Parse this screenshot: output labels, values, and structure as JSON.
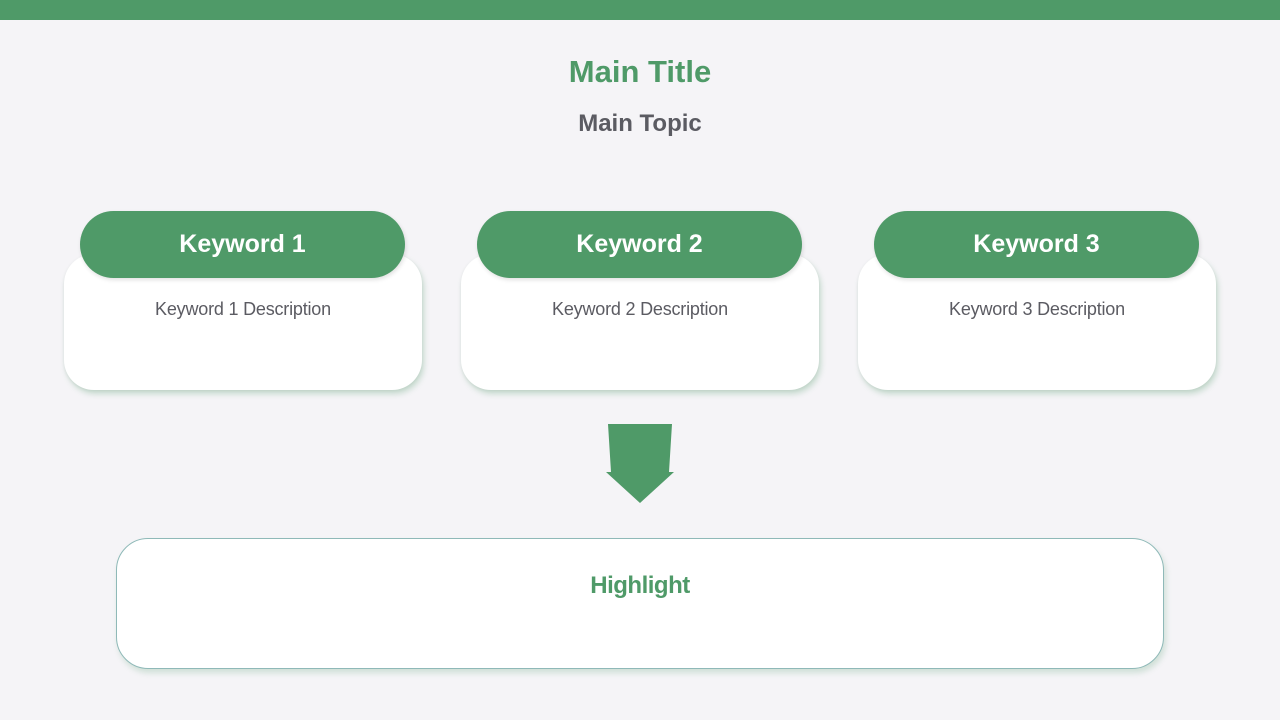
{
  "header": {
    "title": "Main Title",
    "topic": "Main Topic"
  },
  "keywords": [
    {
      "label": "Keyword 1",
      "description": "Keyword 1 Description"
    },
    {
      "label": "Keyword 2",
      "description": "Keyword 2 Description"
    },
    {
      "label": "Keyword 3",
      "description": "Keyword 3 Description"
    }
  ],
  "highlight": {
    "label": "Highlight"
  },
  "colors": {
    "accent": "#4f9a68",
    "text": "#5b5b62",
    "background": "#f5f4f7"
  }
}
